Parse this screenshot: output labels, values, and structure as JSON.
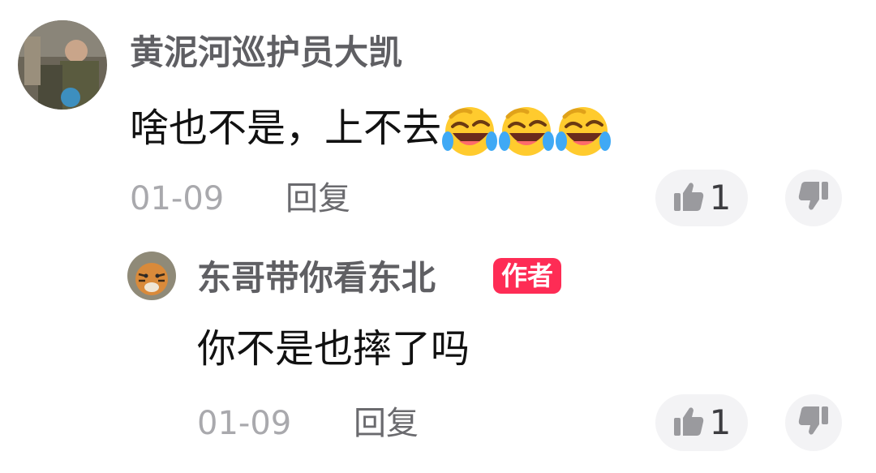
{
  "comments": [
    {
      "username": "黄泥河巡护员大凯",
      "text": "啥也不是，上不去",
      "emojis": [
        "laughing-crying-emoji",
        "laughing-crying-emoji",
        "laughing-crying-emoji"
      ],
      "date": "01-09",
      "reply_label": "回复",
      "like_count": "1"
    }
  ],
  "replies": [
    {
      "username": "东哥带你看东北",
      "author_badge": "作者",
      "text": "你不是也摔了吗",
      "date": "01-09",
      "reply_label": "回复",
      "like_count": "1"
    }
  ],
  "icons": {
    "like": "thumbs-up-icon",
    "dislike": "thumbs-down-icon"
  },
  "colors": {
    "badge": "#fe2c55",
    "username": "#5f5f63",
    "meta": "#a9a9ad"
  }
}
